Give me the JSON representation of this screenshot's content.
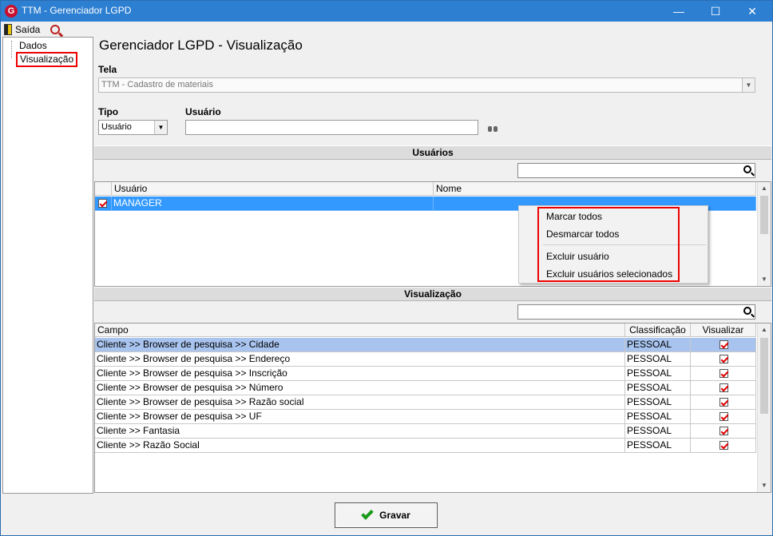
{
  "window": {
    "title": "TTM - Gerenciador LGPD",
    "app_icon_letter": "G",
    "minimize": "—",
    "maximize": "☐",
    "close": "✕"
  },
  "toolbar": {
    "exit_label": "Saída"
  },
  "tree": {
    "items": [
      "Dados",
      "Visualização"
    ],
    "selected": "Visualização"
  },
  "page": {
    "title": "Gerenciador LGPD - Visualização",
    "tela_label": "Tela",
    "tela_value": "TTM - Cadastro de materiais",
    "tipo_label": "Tipo",
    "tipo_value": "Usuário",
    "usuario_label": "Usuário",
    "usuario_value": ""
  },
  "users_section": {
    "header": "Usuários",
    "search_value": "",
    "columns": [
      "Usuário",
      "Nome"
    ],
    "rows": [
      {
        "checked": true,
        "usuario": "MANAGER",
        "nome": ""
      }
    ]
  },
  "context_menu": {
    "items": [
      "Marcar todos",
      "Desmarcar todos",
      "Excluir usuário",
      "Excluir usuários selecionados"
    ]
  },
  "visualization_section": {
    "header": "Visualização",
    "search_value": "",
    "columns": [
      "Campo",
      "Classificação",
      "Visualizar"
    ],
    "rows": [
      {
        "campo": "Cliente >> Browser de pesquisa >> Cidade",
        "classificacao": "PESSOAL",
        "visualizar": true
      },
      {
        "campo": "Cliente >> Browser de pesquisa >> Endereço",
        "classificacao": "PESSOAL",
        "visualizar": true
      },
      {
        "campo": "Cliente >> Browser de pesquisa >> Inscrição",
        "classificacao": "PESSOAL",
        "visualizar": true
      },
      {
        "campo": "Cliente >> Browser de pesquisa >> Número",
        "classificacao": "PESSOAL",
        "visualizar": true
      },
      {
        "campo": "Cliente >> Browser de pesquisa >> Razão social",
        "classificacao": "PESSOAL",
        "visualizar": true
      },
      {
        "campo": "Cliente >> Browser de pesquisa >> UF",
        "classificacao": "PESSOAL",
        "visualizar": true
      },
      {
        "campo": "Cliente >> Fantasia",
        "classificacao": "PESSOAL",
        "visualizar": true
      },
      {
        "campo": "Cliente >> Razão Social",
        "classificacao": "PESSOAL",
        "visualizar": true
      }
    ]
  },
  "footer": {
    "save_label": "Gravar"
  },
  "colors": {
    "titlebar": "#2d7fd2",
    "selection": "#3399ff",
    "highlight_border": "#e00000",
    "check": "#e00000"
  }
}
